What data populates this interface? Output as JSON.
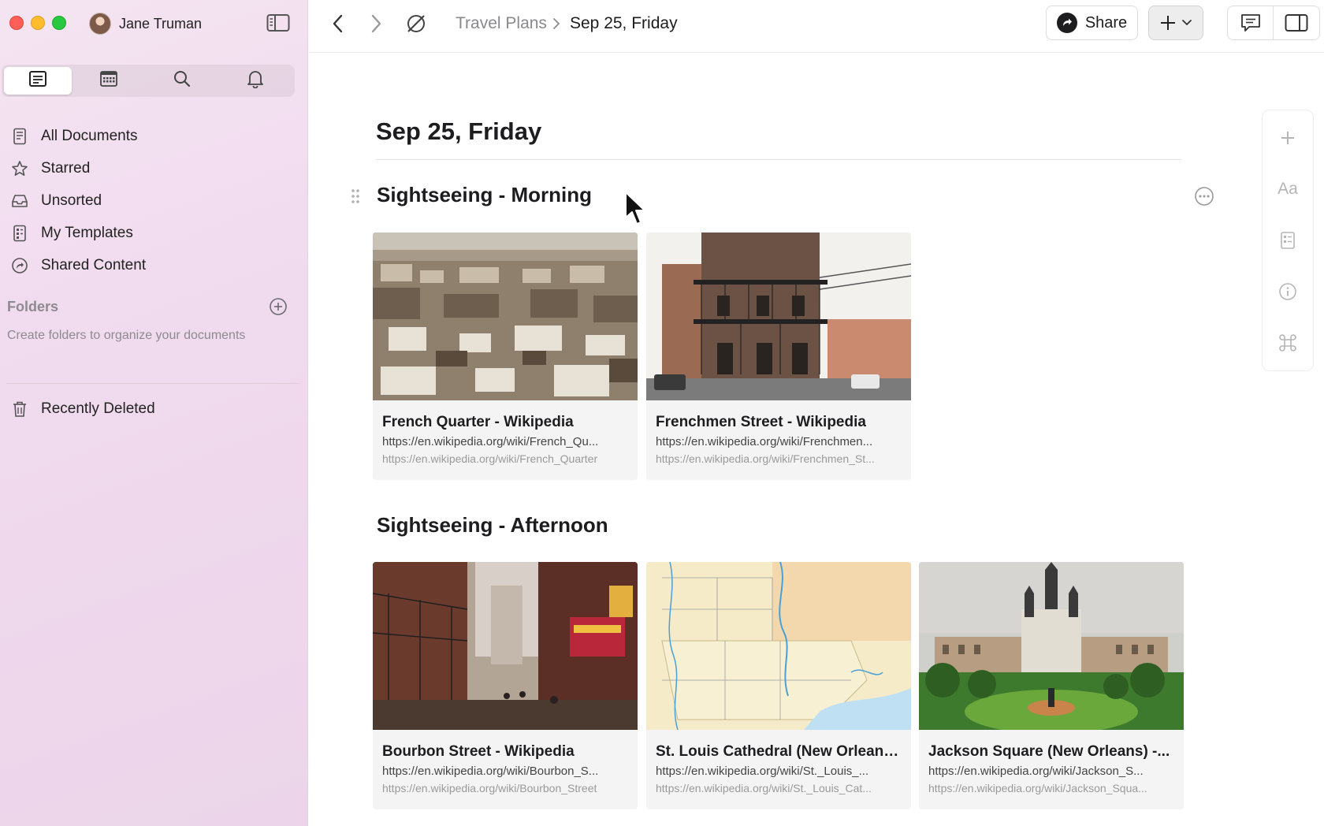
{
  "window": {
    "user_name": "Jane Truman"
  },
  "sidebar": {
    "tabs": [
      {
        "name": "documents-tab",
        "icon": "document-icon",
        "active": true
      },
      {
        "name": "calendar-tab",
        "icon": "calendar-icon",
        "active": false
      },
      {
        "name": "search-tab",
        "icon": "search-icon",
        "active": false
      },
      {
        "name": "notifications-tab",
        "icon": "bell-icon",
        "active": false
      }
    ],
    "items": [
      {
        "label": "All Documents",
        "icon": "document-stack-icon"
      },
      {
        "label": "Starred",
        "icon": "star-icon"
      },
      {
        "label": "Unsorted",
        "icon": "tray-icon"
      },
      {
        "label": "My Templates",
        "icon": "template-icon"
      },
      {
        "label": "Shared Content",
        "icon": "shared-icon"
      }
    ],
    "folders_heading": "Folders",
    "folders_hint": "Create folders to organize your documents",
    "recently_deleted": "Recently Deleted"
  },
  "topbar": {
    "breadcrumb_parent": "Travel Plans",
    "breadcrumb_current": "Sep 25, Friday",
    "share_label": "Share"
  },
  "document": {
    "title": "Sep 25, Friday",
    "sections": [
      {
        "title": "Sightseeing - Morning",
        "cards": [
          {
            "title": "French Quarter - Wikipedia",
            "url": "https://en.wikipedia.org/wiki/French_Qu...",
            "source": "https://en.wikipedia.org/wiki/French_Quarter",
            "image": "aerial-city-rooftops"
          },
          {
            "title": "Frenchmen Street - Wikipedia",
            "url": "https://en.wikipedia.org/wiki/Frenchmen...",
            "source": "https://en.wikipedia.org/wiki/Frenchmen_St...",
            "image": "iron-balcony-building"
          }
        ]
      },
      {
        "title": "Sightseeing - Afternoon",
        "cards": [
          {
            "title": "Bourbon Street - Wikipedia",
            "url": "https://en.wikipedia.org/wiki/Bourbon_S...",
            "source": "https://en.wikipedia.org/wiki/Bourbon_Street",
            "image": "neon-street"
          },
          {
            "title": "St. Louis Cathedral (New Orleans...",
            "url": "https://en.wikipedia.org/wiki/St._Louis_...",
            "source": "https://en.wikipedia.org/wiki/St._Louis_Cat...",
            "image": "map"
          },
          {
            "title": "Jackson Square (New Orleans) -...",
            "url": "https://en.wikipedia.org/wiki/Jackson_S...",
            "source": "https://en.wikipedia.org/wiki/Jackson_Squa...",
            "image": "cathedral-square"
          }
        ]
      }
    ]
  },
  "rail": {
    "text_style_label": "Aa"
  },
  "colors": {
    "sidebar_bg": "#f1dcef",
    "traffic_red": "#fe5f57",
    "traffic_yellow": "#febc2e",
    "traffic_green": "#28c840"
  }
}
